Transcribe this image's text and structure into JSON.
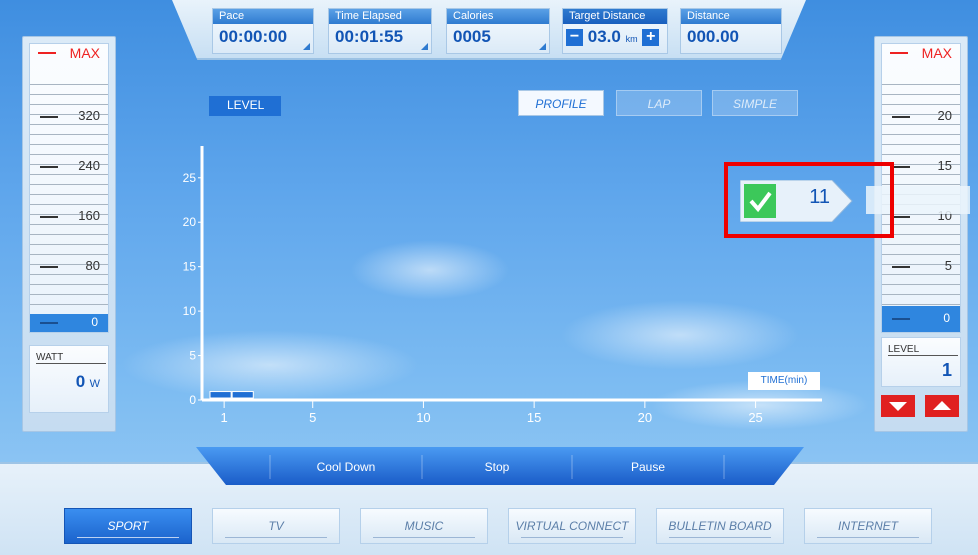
{
  "stats": {
    "pace": {
      "label": "Pace",
      "value": "00:00:00"
    },
    "time_elapsed": {
      "label": "Time Elapsed",
      "value": "00:01:55"
    },
    "calories": {
      "label": "Calories",
      "value": "0005"
    },
    "target_distance": {
      "label": "Target Distance",
      "value": "03.0",
      "unit": "km",
      "minus": "−",
      "plus": "+"
    },
    "distance": {
      "label": "Distance",
      "value": "000.00"
    }
  },
  "watt_panel": {
    "max_label": "MAX",
    "scale": [
      "320",
      "240",
      "160",
      "80",
      "0"
    ],
    "readout_label": "WATT",
    "readout_value": "0",
    "readout_unit": "W"
  },
  "level_panel": {
    "max_label": "MAX",
    "scale": [
      "20",
      "15",
      "10",
      "5",
      "0"
    ],
    "readout_label": "LEVEL",
    "readout_value": "1",
    "down_icon": "triangle-down-icon",
    "up_icon": "triangle-up-icon"
  },
  "chart": {
    "badge": "LEVEL",
    "x_axis_label": "TIME(min)",
    "y_ticks": [
      "0",
      "5",
      "10",
      "15",
      "20",
      "25"
    ],
    "x_ticks": [
      "1",
      "5",
      "10",
      "15",
      "20",
      "25"
    ],
    "modes": [
      "PROFILE",
      "LAP",
      "SIMPLE"
    ],
    "active_mode": "PROFILE"
  },
  "chart_data": {
    "type": "bar",
    "title": "",
    "xlabel": "TIME(min)",
    "ylabel": "LEVEL",
    "x": [
      1,
      2
    ],
    "values": [
      1,
      1
    ],
    "ylim": [
      0,
      27
    ],
    "xlim": [
      0,
      28
    ],
    "grid": false
  },
  "level_popup": {
    "value": "11",
    "check_icon": "check-icon"
  },
  "controls": [
    "Cool Down",
    "Stop",
    "Pause"
  ],
  "nav": [
    "SPORT",
    "TV",
    "MUSIC",
    "VIRTUAL CONNECT",
    "BULLETIN BOARD",
    "INTERNET"
  ],
  "active_nav": "SPORT",
  "colors": {
    "accent": "#1f6fd4",
    "alert": "#e02020",
    "sky": "#5fa6ec"
  }
}
